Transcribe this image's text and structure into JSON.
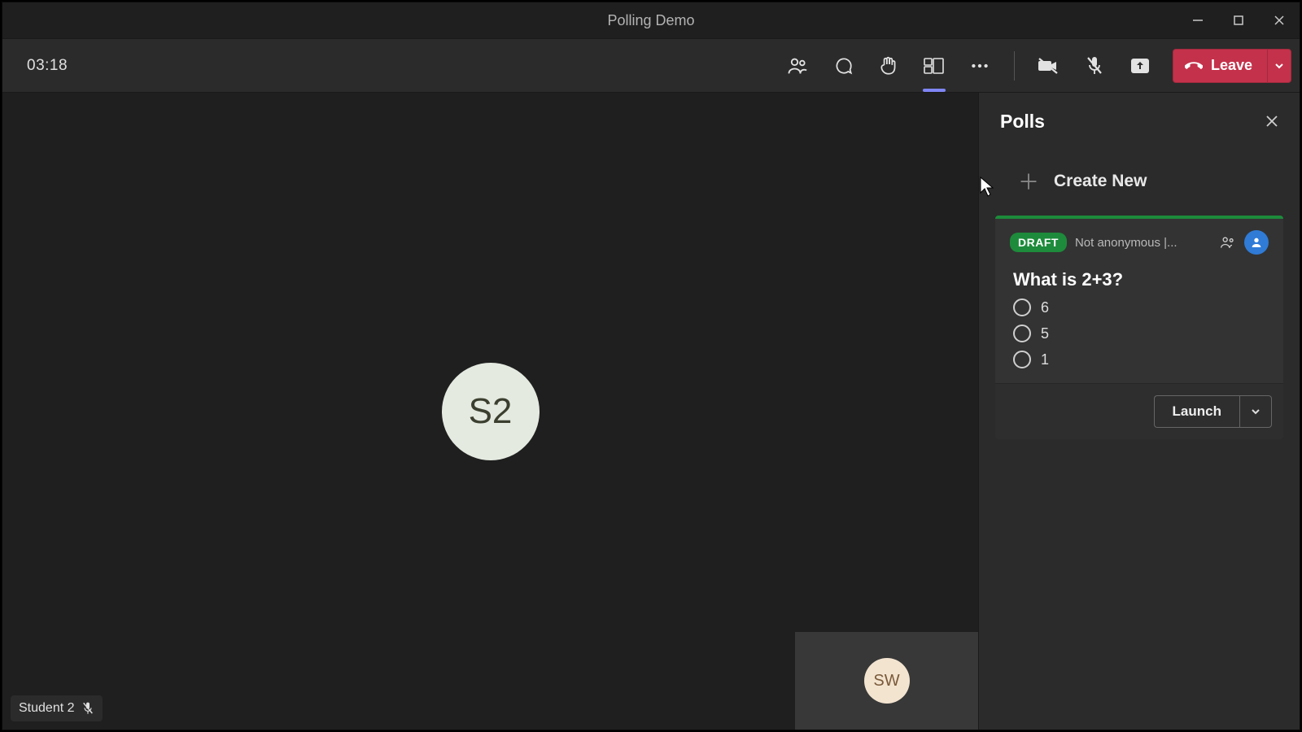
{
  "window": {
    "title": "Polling Demo"
  },
  "toolbar": {
    "timer": "03:18",
    "leave_label": "Leave"
  },
  "stage": {
    "main_avatar_initials": "S2",
    "self_avatar_initials": "SW",
    "participant_name": "Student 2"
  },
  "panel": {
    "title": "Polls",
    "create_new_label": "Create New",
    "poll": {
      "status_badge": "DRAFT",
      "meta_text": "Not anonymous |...",
      "question": "What is 2+3?",
      "options": [
        "6",
        "5",
        "1"
      ],
      "launch_label": "Launch"
    }
  }
}
